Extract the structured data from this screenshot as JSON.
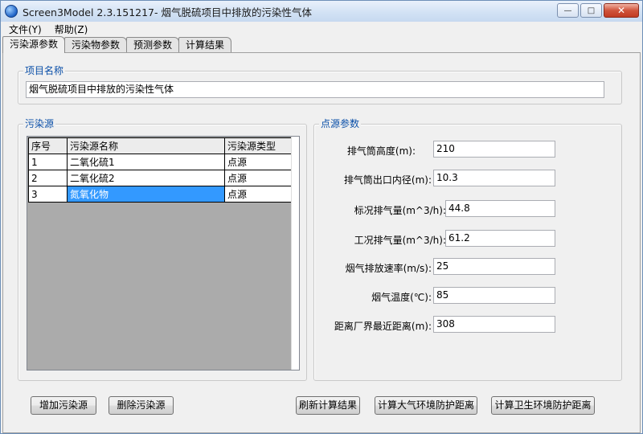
{
  "window": {
    "title": "Screen3Model 2.3.151217- 烟气脱硫项目中排放的污染性气体",
    "controls": {
      "minimize": "—",
      "maximize": "□",
      "close": "✕"
    }
  },
  "menu": {
    "items": [
      "文件(Y)",
      "帮助(Z)"
    ]
  },
  "tabs": [
    "污染源参数",
    "污染物参数",
    "预测参数",
    "计算结果"
  ],
  "project": {
    "group_label": "项目名称",
    "name_value": "烟气脱硫项目中排放的污染性气体"
  },
  "sources": {
    "group_label": "污染源",
    "columns": [
      "序号",
      "污染源名称",
      "污染源类型"
    ],
    "rows": [
      {
        "id": "1",
        "name": "二氧化硫1",
        "type": "点源"
      },
      {
        "id": "2",
        "name": "二氧化硫2",
        "type": "点源"
      },
      {
        "id": "3",
        "name": "氮氧化物",
        "type": "点源"
      }
    ],
    "selected_row": 2
  },
  "point_source": {
    "group_label": "点源参数",
    "fields": [
      {
        "label": "排气筒高度(m):",
        "value": "210"
      },
      {
        "label": "排气筒出口内径(m):",
        "value": "10.3"
      },
      {
        "label": "标况排气量(m^3/h):",
        "value": "44.8"
      },
      {
        "label": "工况排气量(m^3/h):",
        "value": "61.2"
      },
      {
        "label": "烟气排放速率(m/s):",
        "value": "25"
      },
      {
        "label": "烟气温度(℃):",
        "value": "85"
      },
      {
        "label": "距离厂界最近距离(m):",
        "value": "308"
      }
    ]
  },
  "buttons": {
    "add_source": "增加污染源",
    "delete_source": "删除污染源",
    "refresh_results": "刷新计算结果",
    "calc_atmos": "计算大气环境防护距离",
    "calc_health": "计算卫生环境防护距离"
  }
}
